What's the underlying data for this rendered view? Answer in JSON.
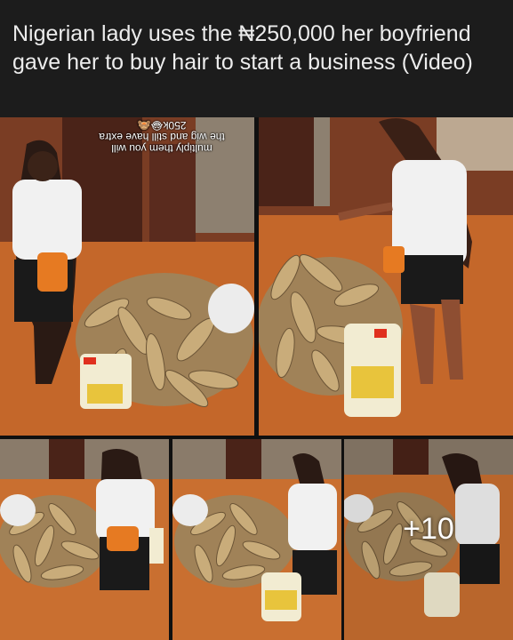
{
  "post": {
    "text": "Nigerian lady uses the ₦250,000 her boyfriend gave her to buy hair to start a business (Video)"
  },
  "photos": [
    {
      "caption_line1": "multiply them you will",
      "caption_line2": "the wig and still have extra",
      "caption_line3": "250k😂🙈"
    },
    {},
    {},
    {},
    {
      "more_count": "+10"
    }
  ],
  "colors": {
    "background": "#1c1c1c",
    "ground": "#c66a2c",
    "text": "#ececec"
  }
}
